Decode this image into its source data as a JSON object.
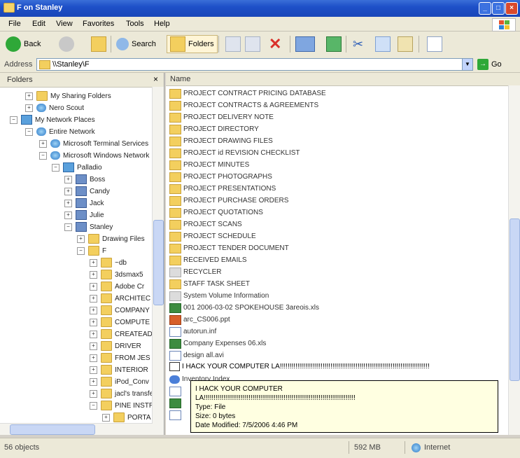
{
  "window": {
    "title": "F on Stanley"
  },
  "menu": [
    "File",
    "Edit",
    "View",
    "Favorites",
    "Tools",
    "Help"
  ],
  "toolbar": {
    "back": "Back",
    "search": "Search",
    "folders": "Folders"
  },
  "address": {
    "label": "Address",
    "value": "\\\\Stanley\\F",
    "go": "Go"
  },
  "folders_pane": {
    "title": "Folders",
    "items": [
      {
        "label": "My Sharing Folders",
        "icon": "folder-icon"
      },
      {
        "label": "Nero Scout",
        "icon": "globe-icon"
      },
      {
        "label": "My Network Places",
        "icon": "network-icon"
      },
      {
        "label": "Entire Network",
        "icon": "globe-icon"
      },
      {
        "label": "Microsoft Terminal Services",
        "icon": "globe-icon"
      },
      {
        "label": "Microsoft Windows Network",
        "icon": "globe-icon"
      },
      {
        "label": "Palladio",
        "icon": "network-icon"
      },
      {
        "label": "Boss",
        "icon": "computer-icon"
      },
      {
        "label": "Candy",
        "icon": "computer-icon"
      },
      {
        "label": "Jack",
        "icon": "computer-icon"
      },
      {
        "label": "Julie",
        "icon": "computer-icon"
      },
      {
        "label": "Stanley",
        "icon": "computer-icon"
      },
      {
        "label": "Drawing Files",
        "icon": "folder-icon"
      },
      {
        "label": "F",
        "icon": "folder-icon"
      },
      {
        "label": "~db",
        "icon": "folder-icon"
      },
      {
        "label": "3dsmax5",
        "icon": "folder-icon"
      },
      {
        "label": "Adobe Cr",
        "icon": "folder-icon"
      },
      {
        "label": "ARCHITEC",
        "icon": "folder-icon"
      },
      {
        "label": "COMPANY",
        "icon": "folder-icon"
      },
      {
        "label": "COMPUTE",
        "icon": "folder-icon"
      },
      {
        "label": "CREATEAD",
        "icon": "folder-icon"
      },
      {
        "label": "DRIVER",
        "icon": "folder-icon"
      },
      {
        "label": "FROM JES",
        "icon": "folder-icon"
      },
      {
        "label": "INTERIOR",
        "icon": "folder-icon"
      },
      {
        "label": "iPod_Conv",
        "icon": "folder-icon"
      },
      {
        "label": "jacl's transfe",
        "icon": "folder-icon"
      },
      {
        "label": "PINE INSTR",
        "icon": "folder-icon"
      },
      {
        "label": "PORTA",
        "icon": "folder-icon"
      }
    ]
  },
  "files_pane": {
    "column": "Name",
    "files": [
      {
        "name": "PROJECT CONTRACT PRICING DATABASE",
        "type": "folder"
      },
      {
        "name": "PROJECT CONTRACTS & AGREEMENTS",
        "type": "folder"
      },
      {
        "name": "PROJECT DELIVERY NOTE",
        "type": "folder"
      },
      {
        "name": "PROJECT DIRECTORY",
        "type": "folder"
      },
      {
        "name": "PROJECT DRAWING FILES",
        "type": "folder"
      },
      {
        "name": "PROJECT id REVISION CHECKLIST",
        "type": "folder"
      },
      {
        "name": "PROJECT MINUTES",
        "type": "folder"
      },
      {
        "name": "PROJECT PHOTOGRAPHS",
        "type": "folder"
      },
      {
        "name": "PROJECT PRESENTATIONS",
        "type": "folder"
      },
      {
        "name": "PROJECT PURCHASE ORDERS",
        "type": "folder"
      },
      {
        "name": "PROJECT QUOTATIONS",
        "type": "folder"
      },
      {
        "name": "PROJECT SCANS",
        "type": "folder"
      },
      {
        "name": "PROJECT SCHEDULE",
        "type": "folder"
      },
      {
        "name": "PROJECT TENDER DOCUMENT",
        "type": "folder"
      },
      {
        "name": "RECEIVED EMAILS",
        "type": "folder"
      },
      {
        "name": "RECYCLER",
        "type": "sysfolder"
      },
      {
        "name": "STAFF TASK SHEET",
        "type": "folder"
      },
      {
        "name": "System Volume Information",
        "type": "sysfolder"
      },
      {
        "name": "001 2006-03-02 SPOKEHOUSE 3areois.xls",
        "type": "xls"
      },
      {
        "name": "arc_CS006.ppt",
        "type": "ppt"
      },
      {
        "name": "autorun.inf",
        "type": "doc"
      },
      {
        "name": "Company Expenses 06.xls",
        "type": "xls"
      },
      {
        "name": "design all.avi",
        "type": "doc"
      }
    ],
    "selected_file": "I HACK YOUR COMPUTER LA!!!!!!!!!!!!!!!!!!!!!!!!!!!!!!!!!!!!!!!!!!!!!!!!!!!!!!!!!!!!!!!!!!!!!!!!!!!!!",
    "partial_rows": [
      {
        "name": "Inventory Index",
        "type": "ie"
      },
      {
        "name": "",
        "type": "doc"
      },
      {
        "name": "",
        "type": "xls"
      },
      {
        "name": "",
        "type": "doc"
      }
    ]
  },
  "tooltip": {
    "line1": "I HACK YOUR COMPUTER",
    "line2": "LA!!!!!!!!!!!!!!!!!!!!!!!!!!!!!!!!!!!!!!!!!!!!!!!!!!!!!!!!!!!!!!!!!!!!!!!!!!!!!!",
    "type": "Type: File",
    "size": "Size: 0 bytes",
    "modified": "Date Modified: 7/5/2006 4:46 PM"
  },
  "status": {
    "objects": "56 objects",
    "size": "592 MB",
    "zone": "Internet"
  }
}
